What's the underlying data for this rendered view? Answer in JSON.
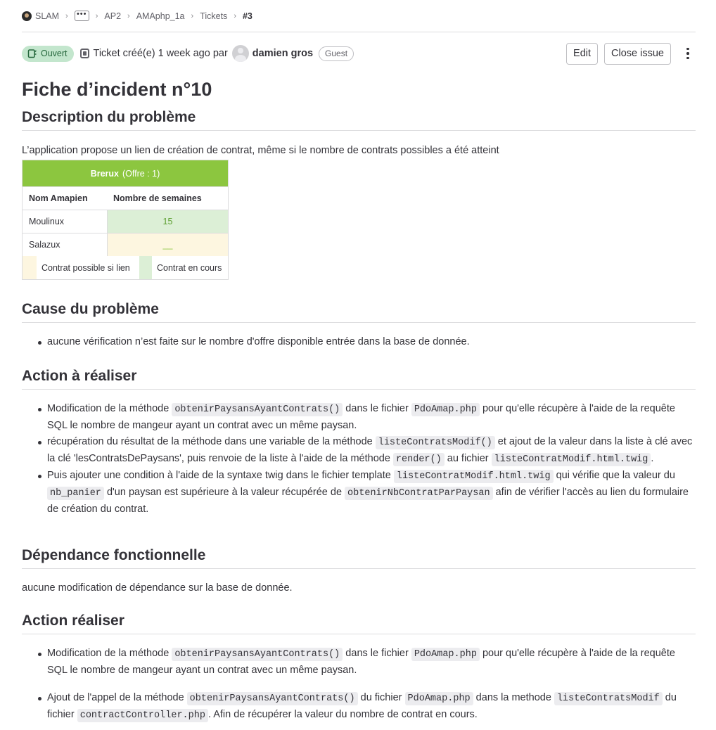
{
  "breadcrumb": {
    "items": [
      "SLAM",
      "AP2",
      "AMAphp_1a",
      "Tickets"
    ],
    "ellipsis": "•••",
    "current": "#3"
  },
  "header": {
    "status": "Ouvert",
    "created_text": "Ticket créé(e) 1 week ago par",
    "author": "damien gros",
    "role": "Guest",
    "edit_label": "Edit",
    "close_label": "Close issue"
  },
  "title": "Fiche d’incident n°10",
  "sections": {
    "description": {
      "heading": "Description du problème",
      "text": "L’application propose un lien de création de contrat, même si le nombre de contrats possibles a été atteint"
    },
    "cause": {
      "heading": "Cause du problème",
      "items": [
        "aucune vérification n’est faite sur le nombre d'offre disponible entrée dans la base de donnée."
      ]
    },
    "action": {
      "heading": "Action à réaliser",
      "item1": {
        "t1": "Modification de la méthode ",
        "c1": "obtenirPaysansAyantContrats()",
        "t2": " dans le fichier ",
        "c2": "PdoAmap.php",
        "t3": " pour qu'elle récupère à l'aide de la requête SQL le nombre de mangeur ayant un contrat avec un même paysan."
      },
      "item2": {
        "t1": "récupération du résultat de la méthode dans une variable de la méthode ",
        "c1": "listeContratsModif()",
        "t2": " et ajout de la valeur dans la liste à clé avec la clé 'lesContratsDePaysans', puis renvoie de la liste à l'aide de la méthode ",
        "c2": "render()",
        "t3": " au fichier ",
        "c3": "listeContratModif.html.twig",
        "t4": "."
      },
      "item3": {
        "t1": "Puis ajouter une condition à l'aide de la syntaxe twig dans le fichier template ",
        "c1": "listeContratModif.html.twig",
        "t2": " qui vérifie que la valeur du ",
        "c2": "nb_panier",
        "t3": " d'un paysan est supérieure à la valeur récupérée de ",
        "c3": "obtenirNbContratParPaysan",
        "t4": " afin de vérifier l'accès au lien du formulaire de création du contrat."
      }
    },
    "dependance": {
      "heading": "Dépendance fonctionnelle",
      "text": "aucune modification de dépendance sur la base de donnée."
    },
    "action2": {
      "heading": "Action réaliser",
      "item1": {
        "t1": "Modification de la méthode ",
        "c1": "obtenirPaysansAyantContrats()",
        "t2": " dans le fichier ",
        "c2": "PdoAmap.php",
        "t3": " pour qu'elle récupère à l'aide de la requête SQL le nombre de mangeur ayant un contrat avec un même paysan."
      },
      "item2": {
        "t1": "Ajout de l'appel de la méthode ",
        "c1": "obtenirPaysansAyantContrats()",
        "t2": " du fichier ",
        "c2": "PdoAmap.php",
        "t3": " dans la methode ",
        "c3": "listeContratsModif",
        "t4": " du fichier ",
        "c4": "contractController.php",
        "t5": ". Afin de récupérer la valeur du nombre de contrat en cours."
      }
    }
  },
  "embedded_table": {
    "title": "Brerux",
    "subtitle": "(Offre : 1)",
    "col1": "Nom Amapien",
    "col2": "Nombre de semaines",
    "rows": [
      {
        "name": "Moulinux",
        "value": "15"
      },
      {
        "name": "Salazux",
        "value": "__"
      }
    ],
    "legend1": "Contrat possible si lien",
    "legend2": "Contrat en cours"
  }
}
